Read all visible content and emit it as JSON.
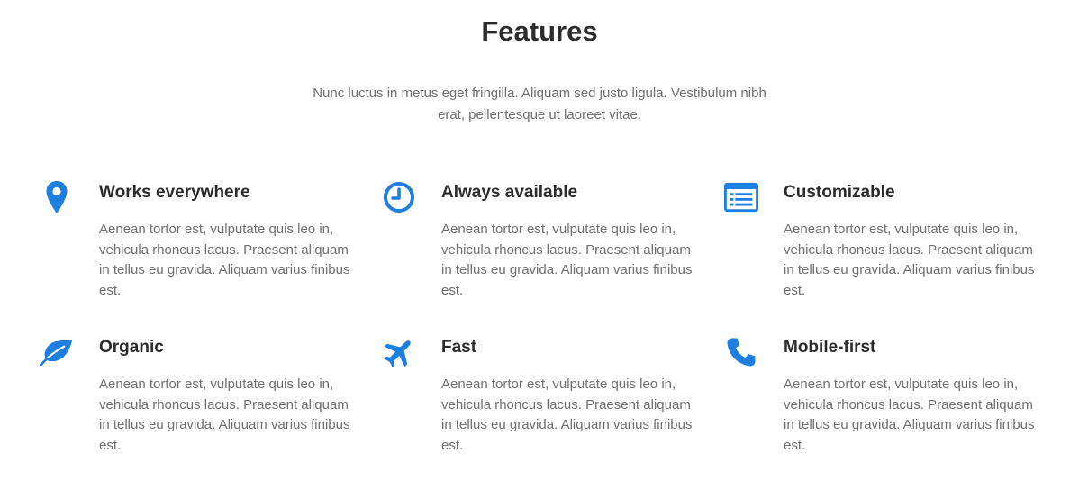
{
  "section": {
    "title": "Features",
    "subtitle": "Nunc luctus in metus eget fringilla. Aliquam sed justo ligula. Vestibulum nibh erat, pellentesque ut laoreet vitae."
  },
  "colors": {
    "accent": "#1e7fe0",
    "heading": "#2b2b2b",
    "body_text": "#6f6f6f",
    "background": "#ffffff"
  },
  "features": [
    {
      "icon": "map-marker-icon",
      "title": "Works everywhere",
      "description": "Aenean tortor est, vulputate quis leo in, vehicula rhoncus lacus. Praesent aliquam in tellus eu gravida. Aliquam varius finibus est."
    },
    {
      "icon": "clock-icon",
      "title": "Always available",
      "description": "Aenean tortor est, vulputate quis leo in, vehicula rhoncus lacus. Praesent aliquam in tellus eu gravida. Aliquam varius finibus est."
    },
    {
      "icon": "list-window-icon",
      "title": "Customizable",
      "description": "Aenean tortor est, vulputate quis leo in, vehicula rhoncus lacus. Praesent aliquam in tellus eu gravida. Aliquam varius finibus est."
    },
    {
      "icon": "leaf-icon",
      "title": "Organic",
      "description": "Aenean tortor est, vulputate quis leo in, vehicula rhoncus lacus. Praesent aliquam in tellus eu gravida. Aliquam varius finibus est."
    },
    {
      "icon": "airplane-icon",
      "title": "Fast",
      "description": "Aenean tortor est, vulputate quis leo in, vehicula rhoncus lacus. Praesent aliquam in tellus eu gravida. Aliquam varius finibus est."
    },
    {
      "icon": "phone-icon",
      "title": "Mobile-first",
      "description": "Aenean tortor est, vulputate quis leo in, vehicula rhoncus lacus. Praesent aliquam in tellus eu gravida. Aliquam varius finibus est."
    }
  ]
}
